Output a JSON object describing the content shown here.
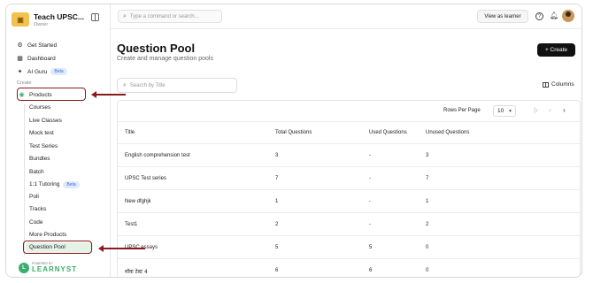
{
  "sidebar": {
    "brand_title": "Teach UPSC...",
    "brand_role": "Owner",
    "nav": [
      {
        "label": "Get Started",
        "icon": "gear-icon"
      },
      {
        "label": "Dashboard",
        "icon": "dashboard-icon"
      },
      {
        "label": "AI Guru",
        "icon": "sparkle-icon",
        "badge": "Beta"
      }
    ],
    "section_label": "Create",
    "products_label": "Products",
    "sub_items": [
      {
        "label": "Courses"
      },
      {
        "label": "Live Classes"
      },
      {
        "label": "Mock test"
      },
      {
        "label": "Test Series"
      },
      {
        "label": "Bundles"
      },
      {
        "label": "Batch"
      },
      {
        "label": "1:1 Tutoring",
        "badge": "Beta"
      },
      {
        "label": "Poll"
      },
      {
        "label": "Tracks"
      },
      {
        "label": "Code"
      },
      {
        "label": "More Products"
      },
      {
        "label": "Question Pool"
      }
    ],
    "footer_small": "POWERED BY",
    "footer_brand": "LEARNYST"
  },
  "topbar": {
    "command_placeholder": "Type a command or search...",
    "view_as_learner": "View as learner"
  },
  "main": {
    "title": "Question Pool",
    "subtitle": "Create and manage question pools",
    "create_label": "+ Create",
    "search_placeholder": "Search by Title",
    "columns_label": "Columns",
    "rows_per_page_label": "Rows Per Page",
    "rows_per_page_value": "10",
    "table": {
      "headers": [
        "Title",
        "Total Questions",
        "Used Questions",
        "Unused Questions"
      ],
      "rows": [
        [
          "English comprehension test",
          "3",
          "-",
          "3"
        ],
        [
          "UPSC Test series",
          "7",
          "-",
          "7"
        ],
        [
          "New dfghjk",
          "1",
          "-",
          "1"
        ],
        [
          "Test1",
          "2",
          "-",
          "2"
        ],
        [
          "UPSC essays",
          "5",
          "5",
          "0"
        ],
        [
          "मॉक टेस्ट 4",
          "6",
          "6",
          "0"
        ]
      ]
    }
  },
  "colors": {
    "annotation": "#8b1a1a",
    "active_bg": "#e6f2e8",
    "brand_green": "#3cae6b"
  }
}
